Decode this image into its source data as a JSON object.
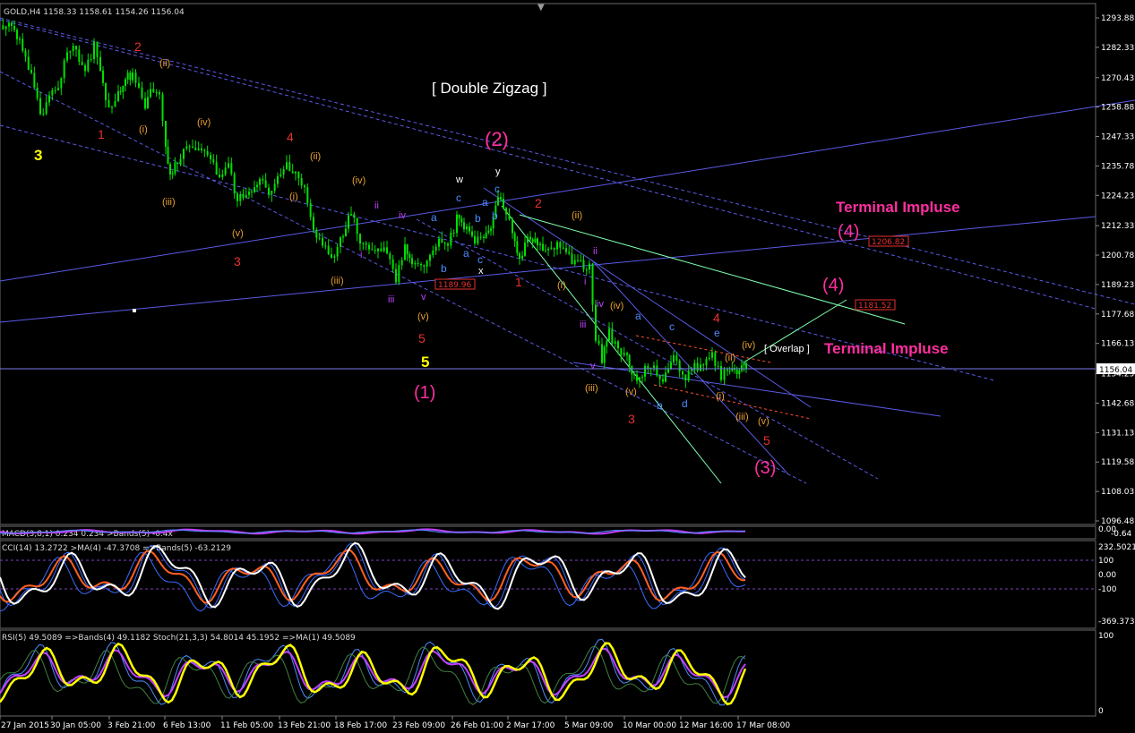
{
  "chart_data": {
    "type": "candlestick",
    "symbol_info": "GOLD,H4  1158.33 1158.61 1154.26 1156.04",
    "current_price": "1156.04",
    "price_axis": {
      "ticks": [
        "1293.88",
        "1282.33",
        "1270.43",
        "1258.88",
        "1247.33",
        "1235.78",
        "1224.23",
        "1212.33",
        "1200.78",
        "1189.23",
        "1177.68",
        "1166.13",
        "1154.23",
        "1142.68",
        "1131.13",
        "1119.58",
        "1108.03",
        "1096.48"
      ],
      "range": [
        1096.48,
        1293.88
      ]
    },
    "time_axis": {
      "ticks": [
        "27 Jan 2015",
        "30 Jan 05:00",
        "3 Feb 21:00",
        "6 Feb 13:00",
        "11 Feb 05:00",
        "13 Feb 21:00",
        "18 Feb 17:00",
        "23 Feb 09:00",
        "26 Feb 01:00",
        "2 Mar 17:00",
        "5 Mar 09:00",
        "10 Mar 00:00",
        "12 Mar 16:00",
        "17 Mar 08:00"
      ]
    },
    "price_path": [
      [
        0,
        1291
      ],
      [
        10,
        1290
      ],
      [
        22,
        1285
      ],
      [
        35,
        1272
      ],
      [
        45,
        1255
      ],
      [
        55,
        1262
      ],
      [
        65,
        1268
      ],
      [
        75,
        1280
      ],
      [
        85,
        1282
      ],
      [
        95,
        1272
      ],
      [
        105,
        1283
      ],
      [
        112,
        1275
      ],
      [
        118,
        1262
      ],
      [
        125,
        1258
      ],
      [
        132,
        1264
      ],
      [
        140,
        1270
      ],
      [
        148,
        1272
      ],
      [
        155,
        1265
      ],
      [
        162,
        1260
      ],
      [
        168,
        1266
      ],
      [
        178,
        1262
      ],
      [
        185,
        1245
      ],
      [
        190,
        1232
      ],
      [
        198,
        1238
      ],
      [
        205,
        1242
      ],
      [
        215,
        1244
      ],
      [
        225,
        1242
      ],
      [
        235,
        1238
      ],
      [
        245,
        1232
      ],
      [
        255,
        1235
      ],
      [
        265,
        1222
      ],
      [
        278,
        1226
      ],
      [
        290,
        1230
      ],
      [
        300,
        1226
      ],
      [
        310,
        1232
      ],
      [
        320,
        1236
      ],
      [
        330,
        1232
      ],
      [
        340,
        1226
      ],
      [
        350,
        1210
      ],
      [
        360,
        1205
      ],
      [
        370,
        1198
      ],
      [
        380,
        1206
      ],
      [
        392,
        1218
      ],
      [
        402,
        1205
      ],
      [
        412,
        1202
      ],
      [
        422,
        1204
      ],
      [
        432,
        1203
      ],
      [
        442,
        1192
      ],
      [
        452,
        1204
      ],
      [
        460,
        1198
      ],
      [
        470,
        1196
      ],
      [
        480,
        1200
      ],
      [
        490,
        1206
      ],
      [
        500,
        1204
      ],
      [
        510,
        1215
      ],
      [
        518,
        1212
      ],
      [
        530,
        1206
      ],
      [
        540,
        1208
      ],
      [
        548,
        1210
      ],
      [
        556,
        1223
      ],
      [
        565,
        1218
      ],
      [
        572,
        1210
      ],
      [
        580,
        1200
      ],
      [
        592,
        1208
      ],
      [
        600,
        1204
      ],
      [
        612,
        1202
      ],
      [
        622,
        1206
      ],
      [
        632,
        1200
      ],
      [
        645,
        1198
      ],
      [
        658,
        1196
      ],
      [
        665,
        1168
      ],
      [
        672,
        1160
      ],
      [
        680,
        1170
      ],
      [
        690,
        1164
      ],
      [
        700,
        1160
      ],
      [
        708,
        1152
      ],
      [
        720,
        1156
      ],
      [
        730,
        1158
      ],
      [
        740,
        1150
      ],
      [
        752,
        1162
      ],
      [
        762,
        1152
      ],
      [
        772,
        1156
      ],
      [
        782,
        1158
      ],
      [
        795,
        1162
      ],
      [
        805,
        1152
      ],
      [
        812,
        1156
      ],
      [
        820,
        1154
      ],
      [
        828,
        1158
      ],
      [
        833,
        1156
      ]
    ],
    "horizontal_price_labels": [
      "1189.96",
      "1206.82",
      "1181.52"
    ],
    "annotations": {
      "double_zigzag": "[ Double Zigzag ]",
      "terminal_1": "Terminal Impluse",
      "terminal_2": "Terminal Impluse",
      "overlap": "[ Overlap ]",
      "w2": "(2)",
      "w1": "(1)",
      "w3": "(3)",
      "w4a": "(4)",
      "w4b": "(4)",
      "y3": "3",
      "y5": "5",
      "r2": "2",
      "r1": "1",
      "r4": "4",
      "r3": "3",
      "r5": "5",
      "r1b": "1",
      "r2b": "2",
      "r4b": "4",
      "r3b": "3",
      "r5b": "5",
      "o_ii_a": "(ii)",
      "o_i_a": "(i)",
      "o_iv_a": "(iv)",
      "o_iii_a": "(iii)",
      "o_v_a": "(v)",
      "o_ii_b": "(ii)",
      "o_i_b": "(i)",
      "o_iv_b": "(iv)",
      "o_iii_b": "(iii)",
      "o_v_b": "(v)",
      "o_ii_c": "(ii)",
      "o_i_c": "(i)",
      "o_iv_c": "(iv)",
      "o_iii_c": "(iii)",
      "o_v_c": "(v)",
      "o_iv_d": "(iv)",
      "o_ii_d": "(ii)",
      "o_i_d": "(i)",
      "o_iii_d": "(iii)",
      "o_v_d": "(v)",
      "p_ii": "ii",
      "p_i": "i",
      "p_iv": "iv",
      "p_iii": "iii",
      "p_v": "v",
      "p_ii2": "ii",
      "p_i2": "i",
      "p_iv2": "iv",
      "p_iii2": "iii",
      "p_v2": "v",
      "b_a1": "a",
      "b_b1": "b",
      "b_c1": "c",
      "b_a2": "a",
      "b_b2": "b",
      "b_c2": "c",
      "b_a3": "a",
      "b_c3": "c",
      "b_e": "e",
      "b_b3": "b",
      "b_d": "d",
      "b_a4": "a",
      "b_b4": "b",
      "b_c4": "c",
      "w_w": "w",
      "w_x": "x",
      "w_y": "y"
    },
    "indicator_headers": {
      "macd": "MACD(3,8,1) 0.234 0.234  >Bands(5) -0.4x",
      "cci": "CCI(14) 13.2722  >MA(4) -47.3708  =>Bands(5) -63.2129",
      "rsi": "RSI(5) 49.5089  =>Bands(4) 49.1182  Stoch(21,3,3) 54.8014 45.1952  =>MA(1) 49.5089"
    },
    "macd_axis": [
      "0.00",
      "-0.64"
    ],
    "cci_axis": [
      "232.5021",
      "100",
      "0.00",
      "-100",
      "-369.3735"
    ],
    "rsi_axis": [
      "100",
      "0"
    ]
  },
  "colors": {
    "background": "#000000",
    "candle": "#00e000",
    "trendline_blue": "#5a5ae6",
    "trendline_green": "#80ffb0",
    "magenta_text": "#ff2fa0",
    "red_text": "#e83030",
    "orange_text": "#e8a030",
    "yellow_text": "#ffff00",
    "blue_text": "#4a8cff",
    "purple_text": "#c040ff",
    "price_line": "#7a7af0"
  }
}
